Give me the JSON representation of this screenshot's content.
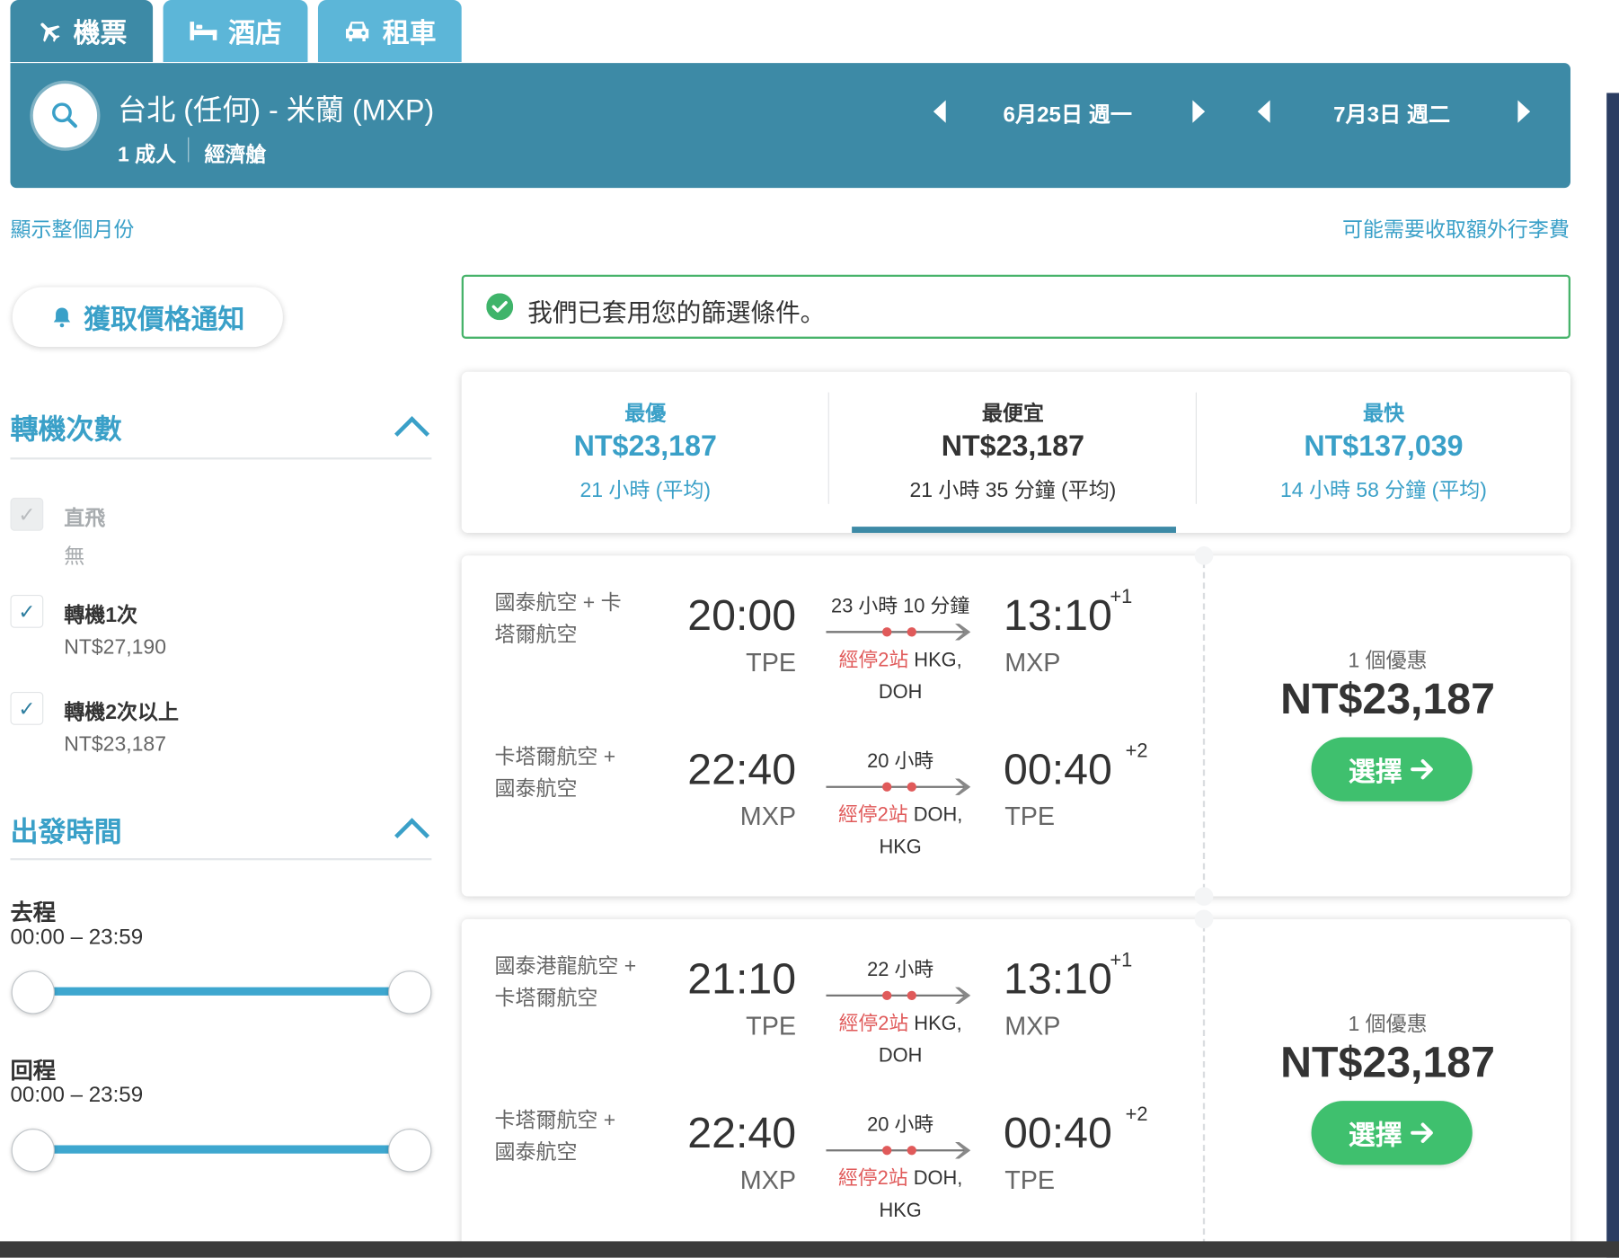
{
  "tabs": [
    {
      "label": "機票",
      "icon": "plane-icon"
    },
    {
      "label": "酒店",
      "icon": "bed-icon"
    },
    {
      "label": "租車",
      "icon": "car-icon"
    }
  ],
  "search": {
    "route": "台北 (任何) - 米蘭 (MXP)",
    "passengers": "1 成人",
    "cabin": "經濟艙",
    "depart_date": "6月25日 週一",
    "return_date": "7月3日 週二"
  },
  "links": {
    "show_month": "顯示整個月份",
    "baggage_fee": "可能需要收取額外行李費"
  },
  "alert_button": "獲取價格通知",
  "filter_notice": "我們已套用您的篩選條件。",
  "stops_filter": {
    "title": "轉機次數",
    "options": [
      {
        "label": "直飛",
        "sub": "無",
        "checked": true,
        "disabled": true
      },
      {
        "label": "轉機1次",
        "sub": "NT$27,190",
        "checked": true,
        "disabled": false
      },
      {
        "label": "轉機2次以上",
        "sub": "NT$23,187",
        "checked": true,
        "disabled": false
      }
    ]
  },
  "time_filter": {
    "title": "出發時間",
    "outbound_label": "去程",
    "outbound_range": "00:00 – 23:59",
    "return_label": "回程",
    "return_range": "00:00 – 23:59"
  },
  "sort_tabs": [
    {
      "label": "最優",
      "price": "NT$23,187",
      "duration": "21 小時 (平均)",
      "active": false
    },
    {
      "label": "最便宜",
      "price": "NT$23,187",
      "duration": "21 小時 35 分鐘 (平均)",
      "active": true
    },
    {
      "label": "最快",
      "price": "NT$137,039",
      "duration": "14 小時 58 分鐘 (平均)",
      "active": false
    }
  ],
  "results": [
    {
      "deals": "1 個優惠",
      "price": "NT$23,187",
      "select_label": "選擇",
      "legs": [
        {
          "airline": "國泰航空 + 卡塔爾航空",
          "depart_time": "20:00",
          "depart_airport": "TPE",
          "duration": "23 小時 10 分鐘",
          "stops_label": "經停2站",
          "stops_airports": "HKG, DOH",
          "arrive_time": "13:10",
          "day_offset": "+1",
          "arrive_airport": "MXP"
        },
        {
          "airline": "卡塔爾航空 + 國泰航空",
          "depart_time": "22:40",
          "depart_airport": "MXP",
          "duration": "20 小時",
          "stops_label": "經停2站",
          "stops_airports": "DOH, HKG",
          "arrive_time": "00:40",
          "day_offset": "+2",
          "arrive_airport": "TPE"
        }
      ]
    },
    {
      "deals": "1 個優惠",
      "price": "NT$23,187",
      "select_label": "選擇",
      "legs": [
        {
          "airline": "國泰港龍航空 + 卡塔爾航空",
          "depart_time": "21:10",
          "depart_airport": "TPE",
          "duration": "22 小時",
          "stops_label": "經停2站",
          "stops_airports": "HKG, DOH",
          "arrive_time": "13:10",
          "day_offset": "+1",
          "arrive_airport": "MXP"
        },
        {
          "airline": "卡塔爾航空 + 國泰航空",
          "depart_time": "22:40",
          "depart_airport": "MXP",
          "duration": "20 小時",
          "stops_label": "經停2站",
          "stops_airports": "DOH, HKG",
          "arrive_time": "00:40",
          "day_offset": "+2",
          "arrive_airport": "TPE"
        }
      ]
    }
  ],
  "colors": {
    "header": "#3d8aa6",
    "accent": "#3aa0c8",
    "select_green": "#3fc06e",
    "stop_red": "#e05a5a"
  }
}
